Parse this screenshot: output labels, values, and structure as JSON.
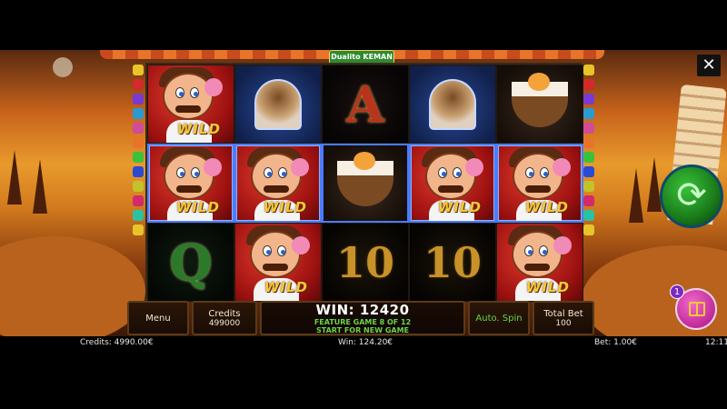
{
  "game": {
    "logo_text": "Dualito KEMAN",
    "close_label": "✕",
    "gift_count": "1",
    "reels": [
      [
        "wild",
        "wild",
        "queen"
      ],
      [
        "sundae",
        "wild",
        "wild"
      ],
      [
        "ace",
        "coconut",
        "ten"
      ],
      [
        "sundae",
        "wild",
        "ten"
      ],
      [
        "coconut",
        "wild",
        "wild"
      ]
    ],
    "symbol_text": {
      "wild": "WILD",
      "ace": "A",
      "queen": "Q",
      "ten": "10"
    }
  },
  "panel": {
    "menu_label": "Menu",
    "credits_label": "Credits",
    "credits_value": "499000",
    "win_line": "WIN: 12420",
    "feature_line": "FEATURE GAME 8 OF 12",
    "start_line": "START FOR NEW GAME",
    "auto_spin_label": "Auto. Spin",
    "total_bet_label": "Total Bet",
    "total_bet_value": "100"
  },
  "status": {
    "credits": "Credits: 4990.00€",
    "win": "Win: 124.20€",
    "bet": "Bet: 1.00€",
    "time": "12:11"
  },
  "colors": {
    "accent_green": "#6ad34a",
    "wild_gold": "#f5c83a",
    "highlight_blue": "#4a7cff"
  }
}
